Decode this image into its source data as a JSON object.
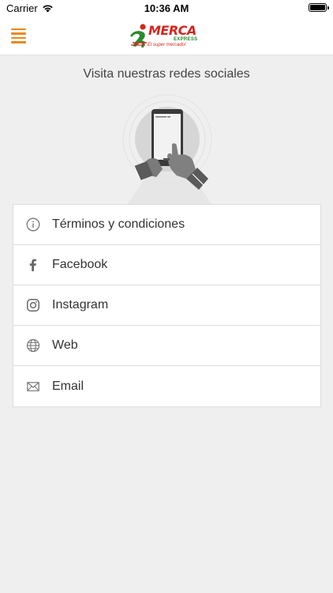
{
  "status_bar": {
    "carrier": "Carrier",
    "time": "10:36 AM"
  },
  "nav": {
    "menu_icon": "hamburger-menu-icon",
    "logo_brand": "MERCA",
    "logo_sub": "EXPRESS",
    "logo_tagline": "El super mercado!"
  },
  "content": {
    "title": "Visita nuestras redes sociales",
    "illustration": "hand-holding-phone-illustration"
  },
  "links": [
    {
      "label": "Términos y condiciones",
      "icon": "info-icon"
    },
    {
      "label": "Facebook",
      "icon": "facebook-icon"
    },
    {
      "label": "Instagram",
      "icon": "instagram-icon"
    },
    {
      "label": "Web",
      "icon": "globe-icon"
    },
    {
      "label": "Email",
      "icon": "envelope-icon"
    }
  ],
  "colors": {
    "accent": "#e8891a",
    "brand_red": "#d4261f",
    "brand_green": "#2a8a2a",
    "background": "#efefef"
  }
}
